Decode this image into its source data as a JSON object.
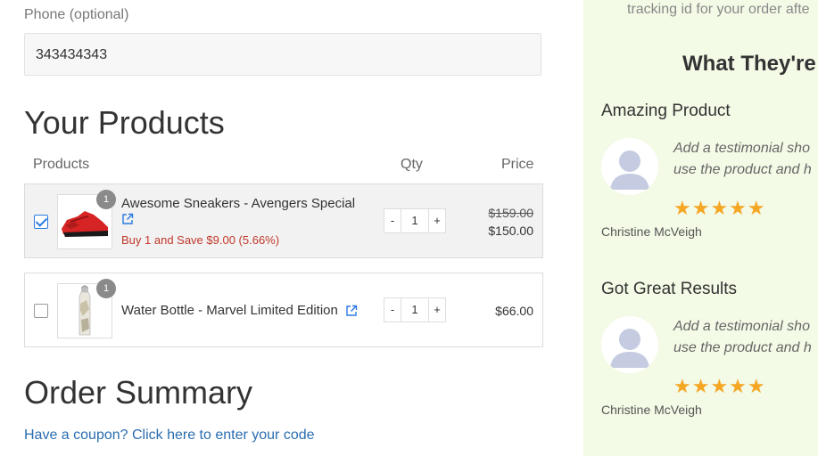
{
  "form": {
    "phone_label": "Phone (optional)",
    "phone_value": "343434343"
  },
  "products_section": {
    "title": "Your Products",
    "headers": {
      "products": "Products",
      "qty": "Qty",
      "price": "Price"
    },
    "items": [
      {
        "name": "Awesome Sneakers - Avengers Special",
        "selected": true,
        "badge": "1",
        "saving": "Buy 1 and Save $9.00 (5.66%)",
        "qty": "1",
        "old_price": "$159.00",
        "price": "$150.00",
        "icon": "external-link-icon"
      },
      {
        "name": "Water Bottle - Marvel Limited Edition",
        "selected": false,
        "badge": "1",
        "qty": "1",
        "price": "$66.00",
        "icon": "external-link-icon"
      }
    ],
    "qty_minus": "-",
    "qty_plus": "+"
  },
  "order_summary": {
    "title": "Order Summary",
    "coupon_link": "Have a coupon? Click here to enter your code"
  },
  "sidebar": {
    "tracking_text": "tracking id for your order afte",
    "heading": "What They're",
    "testimonials": [
      {
        "title": "Amazing Product",
        "text_line1": "Add a testimonial sho",
        "text_line2": "use the product and h",
        "stars": "★★★★★",
        "name": "Christine McVeigh"
      },
      {
        "title": "Got Great Results",
        "text_line1": "Add a testimonial sho",
        "text_line2": "use the product and h",
        "stars": "★★★★★",
        "name": "Christine McVeigh"
      }
    ]
  },
  "colors": {
    "sidebar_bg": "#f3fae6",
    "link": "#2a6db0",
    "saving": "#c0392b",
    "star": "#f5a623",
    "checkbox": "#2a7ae2"
  }
}
